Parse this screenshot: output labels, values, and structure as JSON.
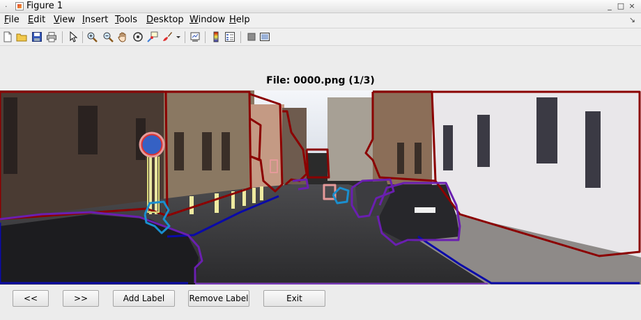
{
  "window": {
    "title": "Figure 1",
    "controls": [
      "_",
      "□",
      "×"
    ]
  },
  "menu": [
    {
      "pre": "",
      "u": "F",
      "post": "ile"
    },
    {
      "pre": "",
      "u": "E",
      "post": "dit"
    },
    {
      "pre": "",
      "u": "V",
      "post": "iew"
    },
    {
      "pre": "",
      "u": "I",
      "post": "nsert"
    },
    {
      "pre": "",
      "u": "T",
      "post": "ools"
    },
    {
      "pre": "",
      "u": "D",
      "post": "esktop"
    },
    {
      "pre": "",
      "u": "W",
      "post": "indow"
    },
    {
      "pre": "",
      "u": "H",
      "post": "elp"
    }
  ],
  "toolbar_icons": [
    "new-file-icon",
    "open-folder-icon",
    "save-icon",
    "print-icon",
    "pointer-icon",
    "zoom-in-icon",
    "zoom-out-icon",
    "pan-hand-icon",
    "rotate-3d-icon",
    "data-cursor-icon",
    "brush-icon",
    "brush-dropdown-icon",
    "link-plot-icon",
    "colorbar-icon",
    "legend-icon",
    "hide-plot-tools-icon",
    "show-plot-tools-icon"
  ],
  "figure": {
    "title": "File: 0000.png (1/3)"
  },
  "buttons": {
    "prev": "<<",
    "next": ">>",
    "add": "Add Label",
    "remove": "Remove Label",
    "exit": "Exit"
  },
  "colors": {
    "building": "#8b0000",
    "sidewalk": "#0a0aa8",
    "car": "#6a1fb0",
    "sign": "#e59a9a",
    "pole": "#d8d87a",
    "bike": "#1a8fcf"
  }
}
